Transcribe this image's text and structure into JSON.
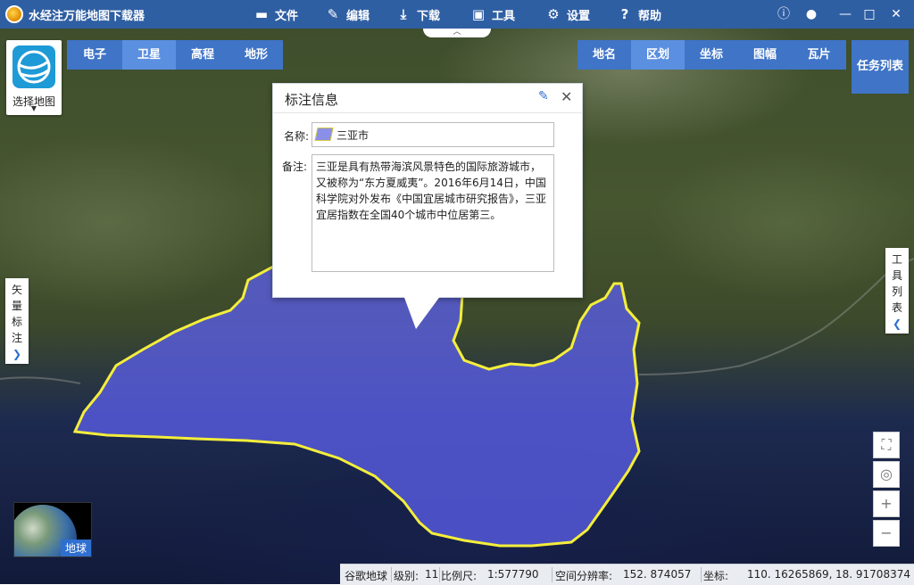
{
  "app": {
    "title": "水经注万能地图下载器",
    "menus": [
      {
        "label": "文件",
        "icon": "folder-icon"
      },
      {
        "label": "编辑",
        "icon": "edit-icon"
      },
      {
        "label": "下载",
        "icon": "download-icon"
      },
      {
        "label": "工具",
        "icon": "toolbox-icon"
      },
      {
        "label": "设置",
        "icon": "gear-icon"
      },
      {
        "label": "帮助",
        "icon": "help-icon"
      }
    ]
  },
  "map_selector": {
    "label": "选择地图"
  },
  "map_types": [
    {
      "label": "电子",
      "active": false
    },
    {
      "label": "卫星",
      "active": true
    },
    {
      "label": "高程",
      "active": false
    },
    {
      "label": "地形",
      "active": false
    }
  ],
  "layer_tabs": [
    {
      "label": "地名",
      "active": false
    },
    {
      "label": "区划",
      "active": true
    },
    {
      "label": "坐标",
      "active": false
    },
    {
      "label": "图幅",
      "active": false
    },
    {
      "label": "瓦片",
      "active": false
    }
  ],
  "task_list": {
    "label": "任务列表"
  },
  "popup": {
    "title": "标注信息",
    "name_label": "名称:",
    "name_value": "三亚市",
    "note_label": "备注:",
    "note_value": "三亚是具有热带海滨风景特色的国际旅游城市，又被称为“东方夏威夷”。2016年6月14日，中国科学院对外发布《中国宜居城市研究报告》，三亚宜居指数在全国40个城市中位居第三。"
  },
  "side_left": {
    "label_chars": [
      "矢",
      "量",
      "标",
      "注"
    ]
  },
  "side_right": {
    "label_chars": [
      "工",
      "具",
      "列",
      "表"
    ]
  },
  "globe": {
    "label": "地球"
  },
  "status": {
    "source": "谷歌地球",
    "level_label": "级别:",
    "level": "11",
    "scale_label": "比例尺:",
    "scale": "1:577790",
    "resolution_label": "空间分辨率:",
    "resolution": "152. 874057",
    "coord_label": "坐标:",
    "lon": "110. 16265869,",
    "lat": "18. 91708374"
  },
  "colors": {
    "titlebar": "#2f5fa3",
    "tab_bar": "#3f74c7",
    "tab_active": "#5b8fe0",
    "region_fill": "#5a5ee6",
    "region_outline": "#f4ee3b"
  }
}
